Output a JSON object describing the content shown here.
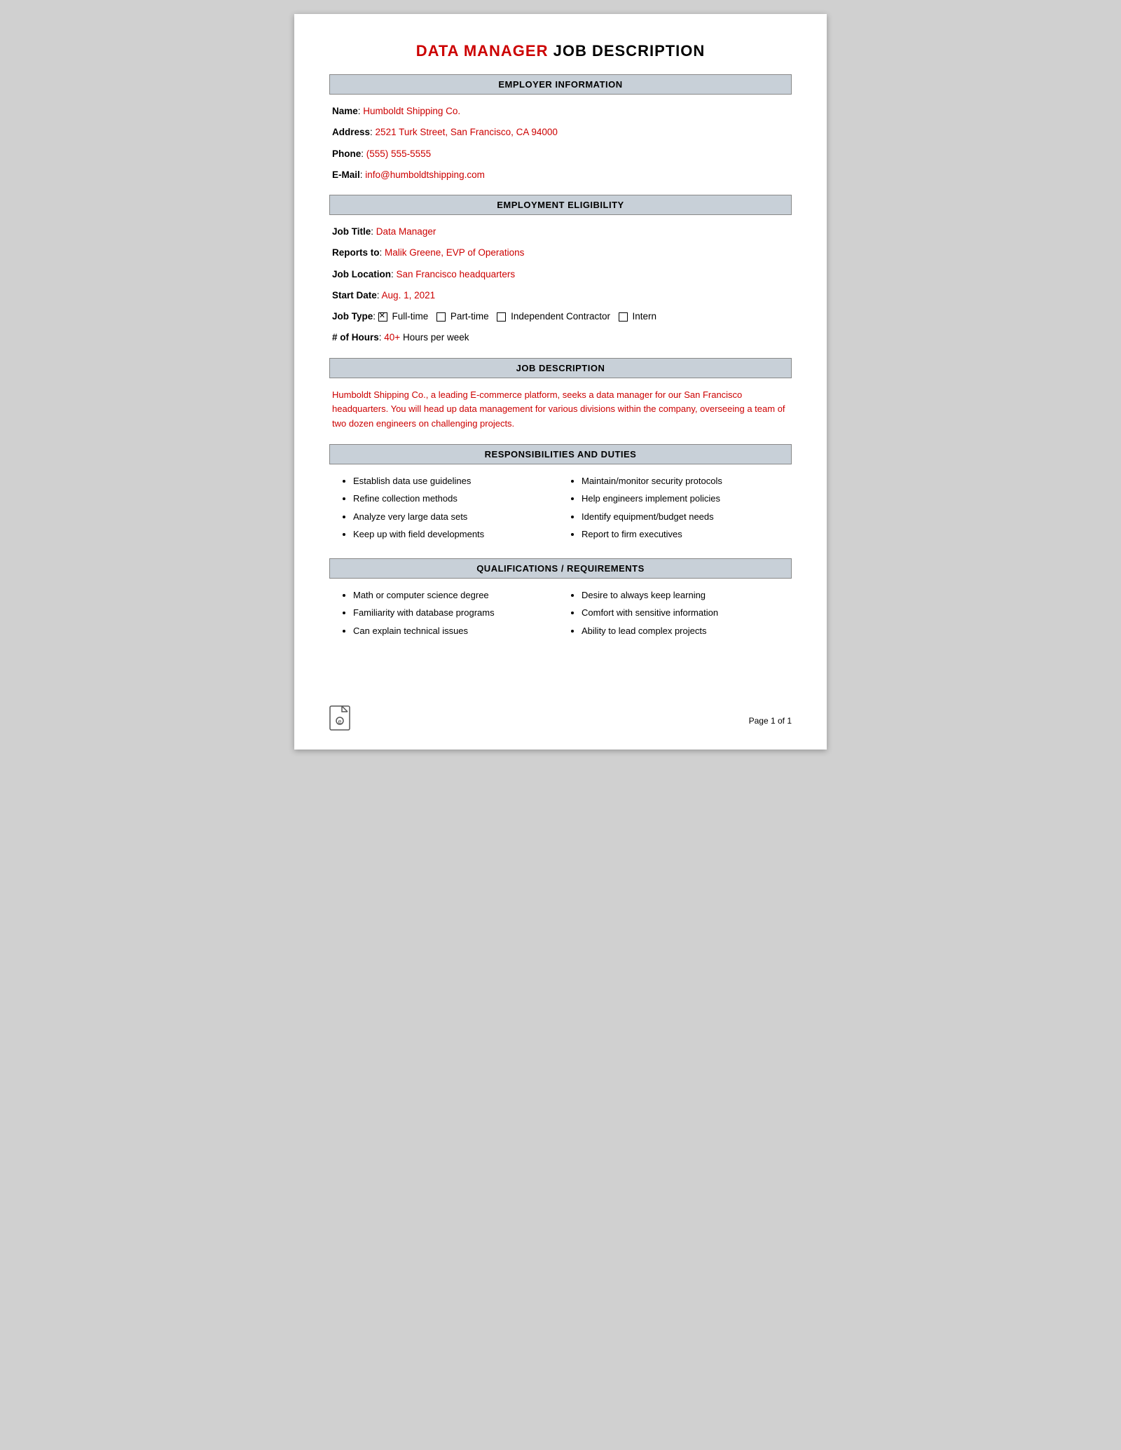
{
  "title": {
    "red_part": "DATA MANAGER",
    "black_part": " JOB DESCRIPTION"
  },
  "employer_info": {
    "header": "EMPLOYER INFORMATION",
    "name_label": "Name",
    "name_value": "Humboldt Shipping Co.",
    "address_label": "Address",
    "address_value": "2521 Turk Street, San Francisco, CA 94000",
    "phone_label": "Phone",
    "phone_value": "(555) 555-5555",
    "email_label": "E-Mail",
    "email_value": "info@humboldtshipping.com"
  },
  "employment_eligibility": {
    "header": "EMPLOYMENT ELIGIBILITY",
    "job_title_label": "Job Title",
    "job_title_value": "Data Manager",
    "reports_to_label": "Reports to",
    "reports_to_value": "Malik Greene, EVP of Operations",
    "job_location_label": "Job Location",
    "job_location_value": "San Francisco headquarters",
    "start_date_label": "Start Date",
    "start_date_value": "Aug. 1, 2021",
    "job_type_label": "Job Type",
    "job_type_fulltime": "Full-time",
    "job_type_parttime": "Part-time",
    "job_type_contractor": "Independent Contractor",
    "job_type_intern": "Intern",
    "hours_label": "# of Hours",
    "hours_value": "40+",
    "hours_suffix": " Hours per week"
  },
  "job_description": {
    "header": "JOB DESCRIPTION",
    "text": "Humboldt Shipping Co., a leading E-commerce platform, seeks a data manager for our San Francisco headquarters. You will head up data management for various divisions within the company, overseeing a team of two dozen engineers on challenging projects."
  },
  "responsibilities": {
    "header": "RESPONSIBILITIES AND DUTIES",
    "left_items": [
      "Establish data use guidelines",
      "Refine collection methods",
      "Analyze very large data sets",
      "Keep up with field developments"
    ],
    "right_items": [
      "Maintain/monitor security protocols",
      "Help engineers implement policies",
      "Identify equipment/budget needs",
      "Report to firm executives"
    ]
  },
  "qualifications": {
    "header": "QUALIFICATIONS / REQUIREMENTS",
    "left_items": [
      "Math or computer science degree",
      "Familiarity with database programs",
      "Can explain technical issues"
    ],
    "right_items": [
      "Desire to always keep learning",
      "Comfort with sensitive information",
      "Ability to lead complex projects"
    ]
  },
  "footer": {
    "page_label": "Page 1 of 1"
  }
}
